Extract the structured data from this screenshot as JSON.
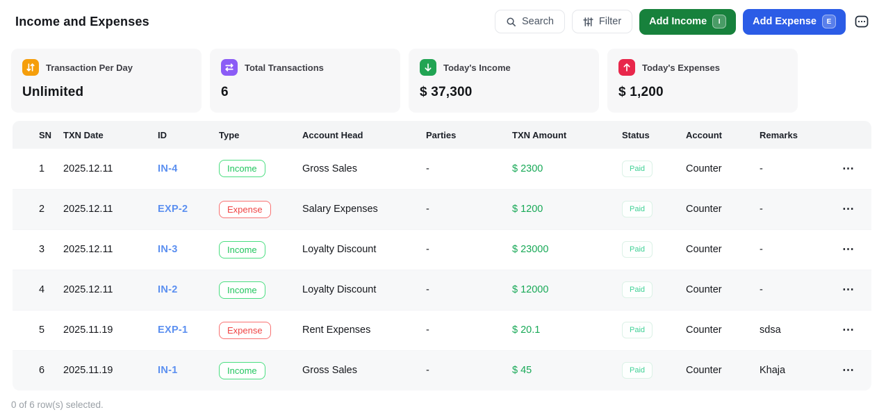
{
  "header": {
    "title": "Income and Expenses",
    "search_label": "Search",
    "filter_label": "Filter",
    "add_income_label": "Add Income",
    "add_income_shortcut": "I",
    "add_expense_label": "Add Expense",
    "add_expense_shortcut": "E"
  },
  "colors": {
    "income_button": "#17813c",
    "expense_button": "#2b5ce6",
    "stat_orange": "#f59e0b",
    "stat_purple": "#8b5cf6",
    "stat_green": "#21a453",
    "stat_red": "#e8274b",
    "amount_green": "#18a957",
    "id_link_blue": "#5b8ff0"
  },
  "stats": [
    {
      "icon": "arrows-down-up-icon",
      "icon_color": "#f59e0b",
      "label": "Transaction Per Day",
      "value": "Unlimited"
    },
    {
      "icon": "arrows-left-right-icon",
      "icon_color": "#8b5cf6",
      "label": "Total Transactions",
      "value": "6"
    },
    {
      "icon": "arrow-down-icon",
      "icon_color": "#21a453",
      "label": "Today's Income",
      "value": "$ 37,300"
    },
    {
      "icon": "arrow-up-icon",
      "icon_color": "#e8274b",
      "label": "Today's Expenses",
      "value": "$ 1,200"
    }
  ],
  "table": {
    "columns": [
      "SN",
      "TXN Date",
      "ID",
      "Type",
      "Account Head",
      "Parties",
      "TXN Amount",
      "Status",
      "Account",
      "Remarks"
    ],
    "rows": [
      {
        "sn": "1",
        "date": "2025.12.11",
        "id": "IN-4",
        "type": "Income",
        "account_head": "Gross Sales",
        "parties": "-",
        "amount": "$ 2300",
        "status": "Paid",
        "account": "Counter",
        "remarks": "-"
      },
      {
        "sn": "2",
        "date": "2025.12.11",
        "id": "EXP-2",
        "type": "Expense",
        "account_head": "Salary Expenses",
        "parties": "-",
        "amount": "$ 1200",
        "status": "Paid",
        "account": "Counter",
        "remarks": "-"
      },
      {
        "sn": "3",
        "date": "2025.12.11",
        "id": "IN-3",
        "type": "Income",
        "account_head": "Loyalty Discount",
        "parties": "-",
        "amount": "$ 23000",
        "status": "Paid",
        "account": "Counter",
        "remarks": "-"
      },
      {
        "sn": "4",
        "date": "2025.12.11",
        "id": "IN-2",
        "type": "Income",
        "account_head": "Loyalty Discount",
        "parties": "-",
        "amount": "$ 12000",
        "status": "Paid",
        "account": "Counter",
        "remarks": "-"
      },
      {
        "sn": "5",
        "date": "2025.11.19",
        "id": "EXP-1",
        "type": "Expense",
        "account_head": "Rent Expenses",
        "parties": "-",
        "amount": "$ 20.1",
        "status": "Paid",
        "account": "Counter",
        "remarks": "sdsa"
      },
      {
        "sn": "6",
        "date": "2025.11.19",
        "id": "IN-1",
        "type": "Income",
        "account_head": "Gross Sales",
        "parties": "-",
        "amount": "$ 45",
        "status": "Paid",
        "account": "Counter",
        "remarks": "Khaja"
      }
    ],
    "row_menu_glyph": "⋯"
  },
  "footer": {
    "selection_text": "0 of 6 row(s) selected."
  }
}
